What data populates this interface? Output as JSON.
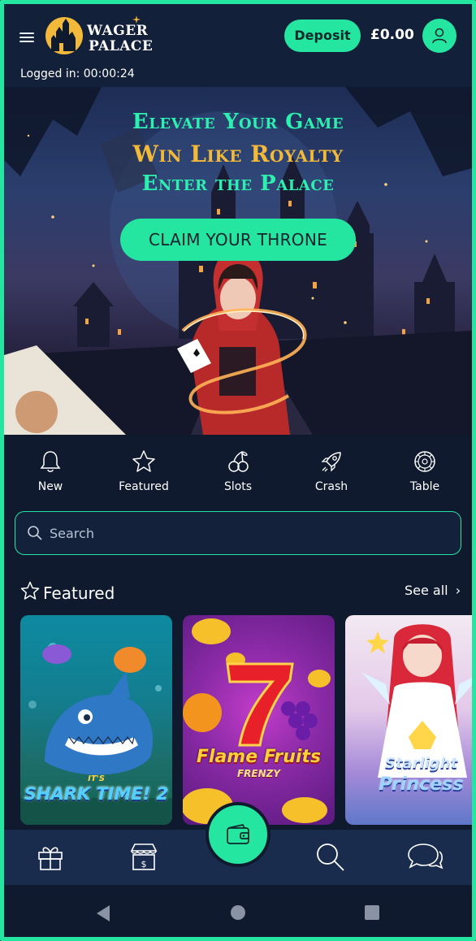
{
  "header": {
    "logo": "WAGER PALACE",
    "logo_line1": "WAGER",
    "logo_line2": "PALACE",
    "deposit_label": "Deposit",
    "balance": "£0.00",
    "logged_in": "Logged in: 00:00:24"
  },
  "hero": {
    "line1": "Elevate Your Game",
    "line2": "Win Like Royalty",
    "line3": "Enter the Palace",
    "cta": "CLAIM YOUR THRONE"
  },
  "categories": [
    {
      "label": "New",
      "icon": "bell-icon"
    },
    {
      "label": "Featured",
      "icon": "star-icon"
    },
    {
      "label": "Slots",
      "icon": "cherries-icon"
    },
    {
      "label": "Crash",
      "icon": "rocket-icon"
    },
    {
      "label": "Table",
      "icon": "roulette-icon"
    }
  ],
  "search": {
    "placeholder": "Search"
  },
  "featured": {
    "title": "Featured",
    "see_all": "See all",
    "games": [
      {
        "title_line1": "IT'S",
        "title_line2": "SHARK TIME! 2"
      },
      {
        "title_line1": "Flame Fruits",
        "title_line2": "FRENZY"
      },
      {
        "title_line1": "Starlight",
        "title_line2": "Princess"
      }
    ]
  },
  "bottom_nav": {
    "items": [
      "gift-icon",
      "store-icon",
      "wallet-icon",
      "search-icon",
      "chat-icon"
    ]
  },
  "colors": {
    "accent": "#25e6a0",
    "background": "#0f1a2e",
    "header": "#12203a",
    "gold": "#f2b93a"
  }
}
